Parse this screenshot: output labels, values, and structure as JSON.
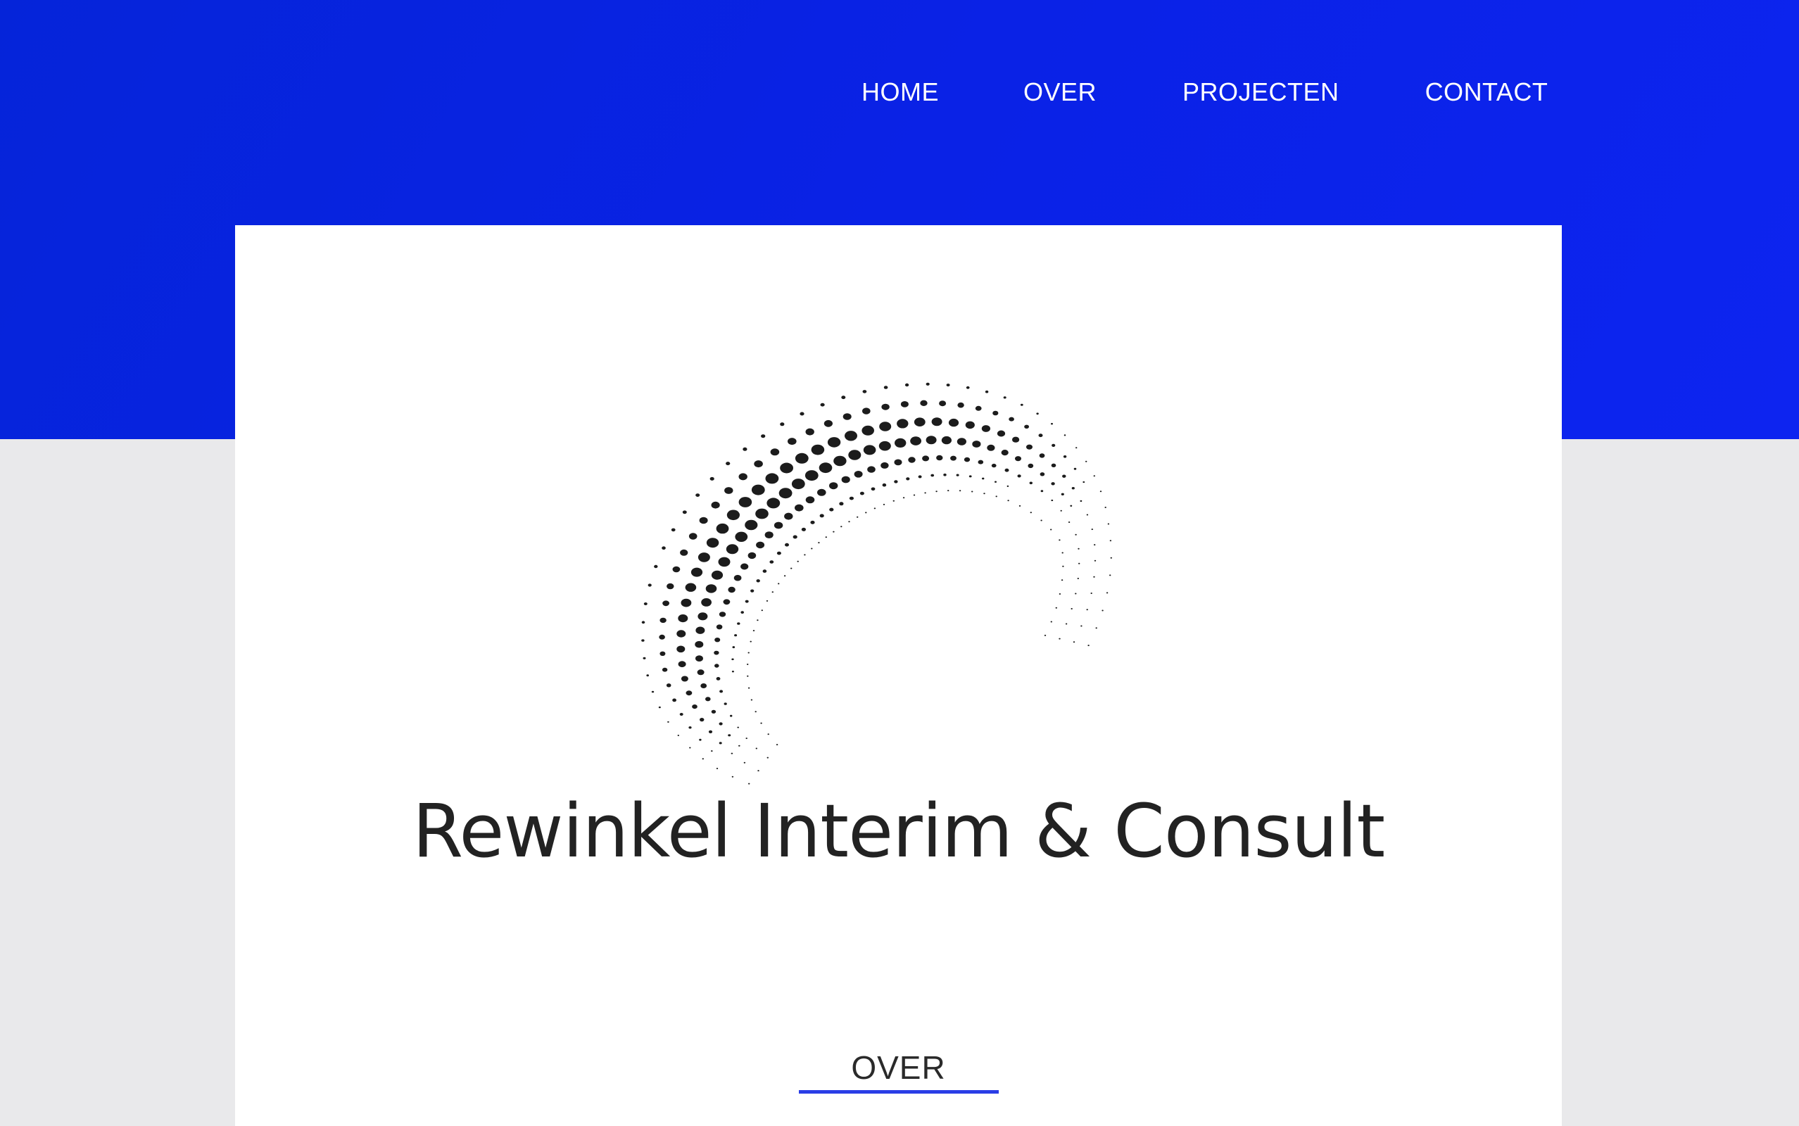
{
  "nav": {
    "items": [
      {
        "label": "HOME"
      },
      {
        "label": "OVER"
      },
      {
        "label": "PROJECTEN"
      },
      {
        "label": "CONTACT"
      }
    ]
  },
  "logo": {
    "brand_name": "Rewinkel Interim & Consult",
    "icon": "dotted-swirl-logo-icon",
    "color": "#1c1c1c"
  },
  "section": {
    "title": "OVER",
    "underline_color": "#2a3de6"
  },
  "colors": {
    "hero_gradient_start": "#0524d9",
    "hero_gradient_end": "#0d24f0",
    "page_background": "#e9e9eb",
    "card_background": "#ffffff"
  }
}
